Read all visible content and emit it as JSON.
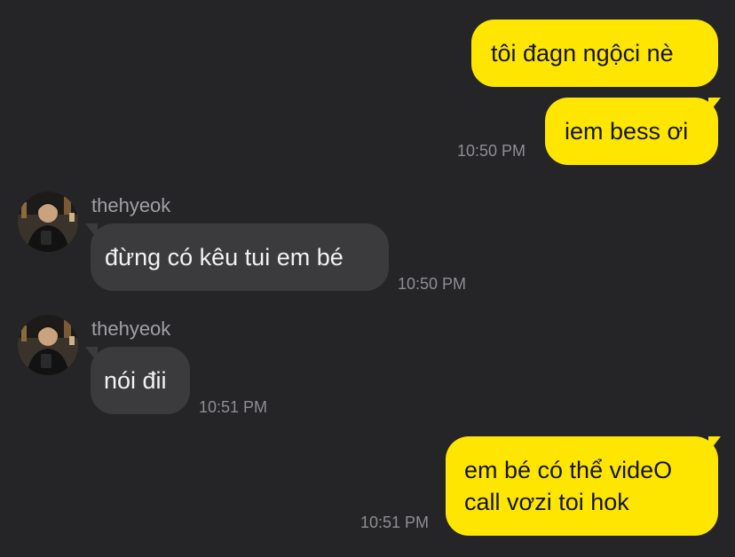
{
  "colors": {
    "background": "#252527",
    "outgoing_bubble": "#FFE600",
    "incoming_bubble": "#3B3B3D",
    "timestamp": "#8E8E93"
  },
  "messages": [
    {
      "direction": "outgoing",
      "text": "tôi đagn ngộci nè"
    },
    {
      "direction": "outgoing",
      "text": "iem bess ơi",
      "time": "10:50 PM"
    },
    {
      "direction": "incoming",
      "sender": "thehyeok",
      "avatar": "profile-photo",
      "text": "đừng có kêu tui em bé",
      "time": "10:50 PM"
    },
    {
      "direction": "incoming",
      "sender": "thehyeok",
      "avatar": "profile-photo",
      "text": "nói đii",
      "time": "10:51 PM"
    },
    {
      "direction": "outgoing",
      "text_lines": [
        "em bé có thể videO",
        "call vơzi toi hok"
      ],
      "time": "10:51 PM"
    }
  ]
}
